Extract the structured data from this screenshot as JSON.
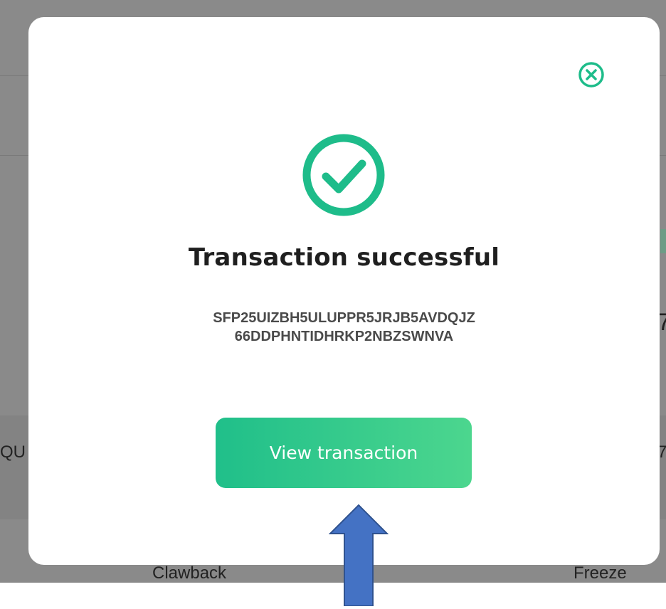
{
  "background": {
    "left_text": "QU",
    "right_digit_top": "7",
    "right_digit_mid": "7",
    "bottom_left_label": "Clawback",
    "bottom_right_label": "Freeze"
  },
  "modal": {
    "close_icon": "close-circle-icon",
    "success_icon": "check-circle-icon",
    "title": "Transaction successful",
    "hash_line1": "SFP25UIZBH5ULUPPR5JRJB5AVDQJZ",
    "hash_line2": "66DDPHNTIDHRKP2NBZSWNVA",
    "view_button_label": "View transaction"
  },
  "annotation": {
    "arrow_icon": "up-arrow-icon",
    "arrow_color": "#4472c4"
  },
  "colors": {
    "accent": "#1ebc8a",
    "button_start": "#20bf8a",
    "button_end": "#4cd68e"
  }
}
